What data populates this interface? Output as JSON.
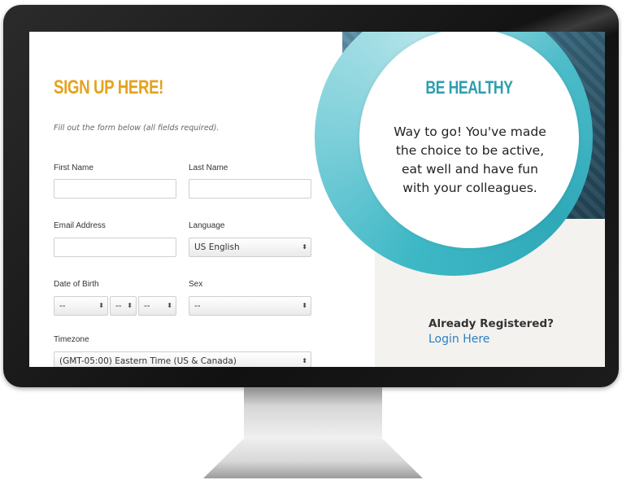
{
  "form": {
    "title": "SIGN UP HERE!",
    "instructions": "Fill out the form below (all fields required).",
    "first_name_label": "First Name",
    "last_name_label": "Last Name",
    "email_label": "Email Address",
    "language_label": "Language",
    "language_value": "US English",
    "dob_label": "Date of Birth",
    "dob_month_value": "--",
    "dob_day_value": "--",
    "dob_year_value": "--",
    "sex_label": "Sex",
    "sex_value": "--",
    "timezone_label": "Timezone",
    "timezone_value": "(GMT-05:00) Eastern Time (US & Canada)",
    "select_arrows": "⬍"
  },
  "hero": {
    "heading": "BE HEALTHY",
    "body": "Way to go! You've made the choice to be active, eat well and have fun with your colleagues."
  },
  "login": {
    "prompt": "Already Registered?",
    "link": "Login Here"
  },
  "colors": {
    "title_orange": "#e6a21d",
    "accent_teal": "#2a9fb0",
    "link_blue": "#2f7fc0"
  }
}
